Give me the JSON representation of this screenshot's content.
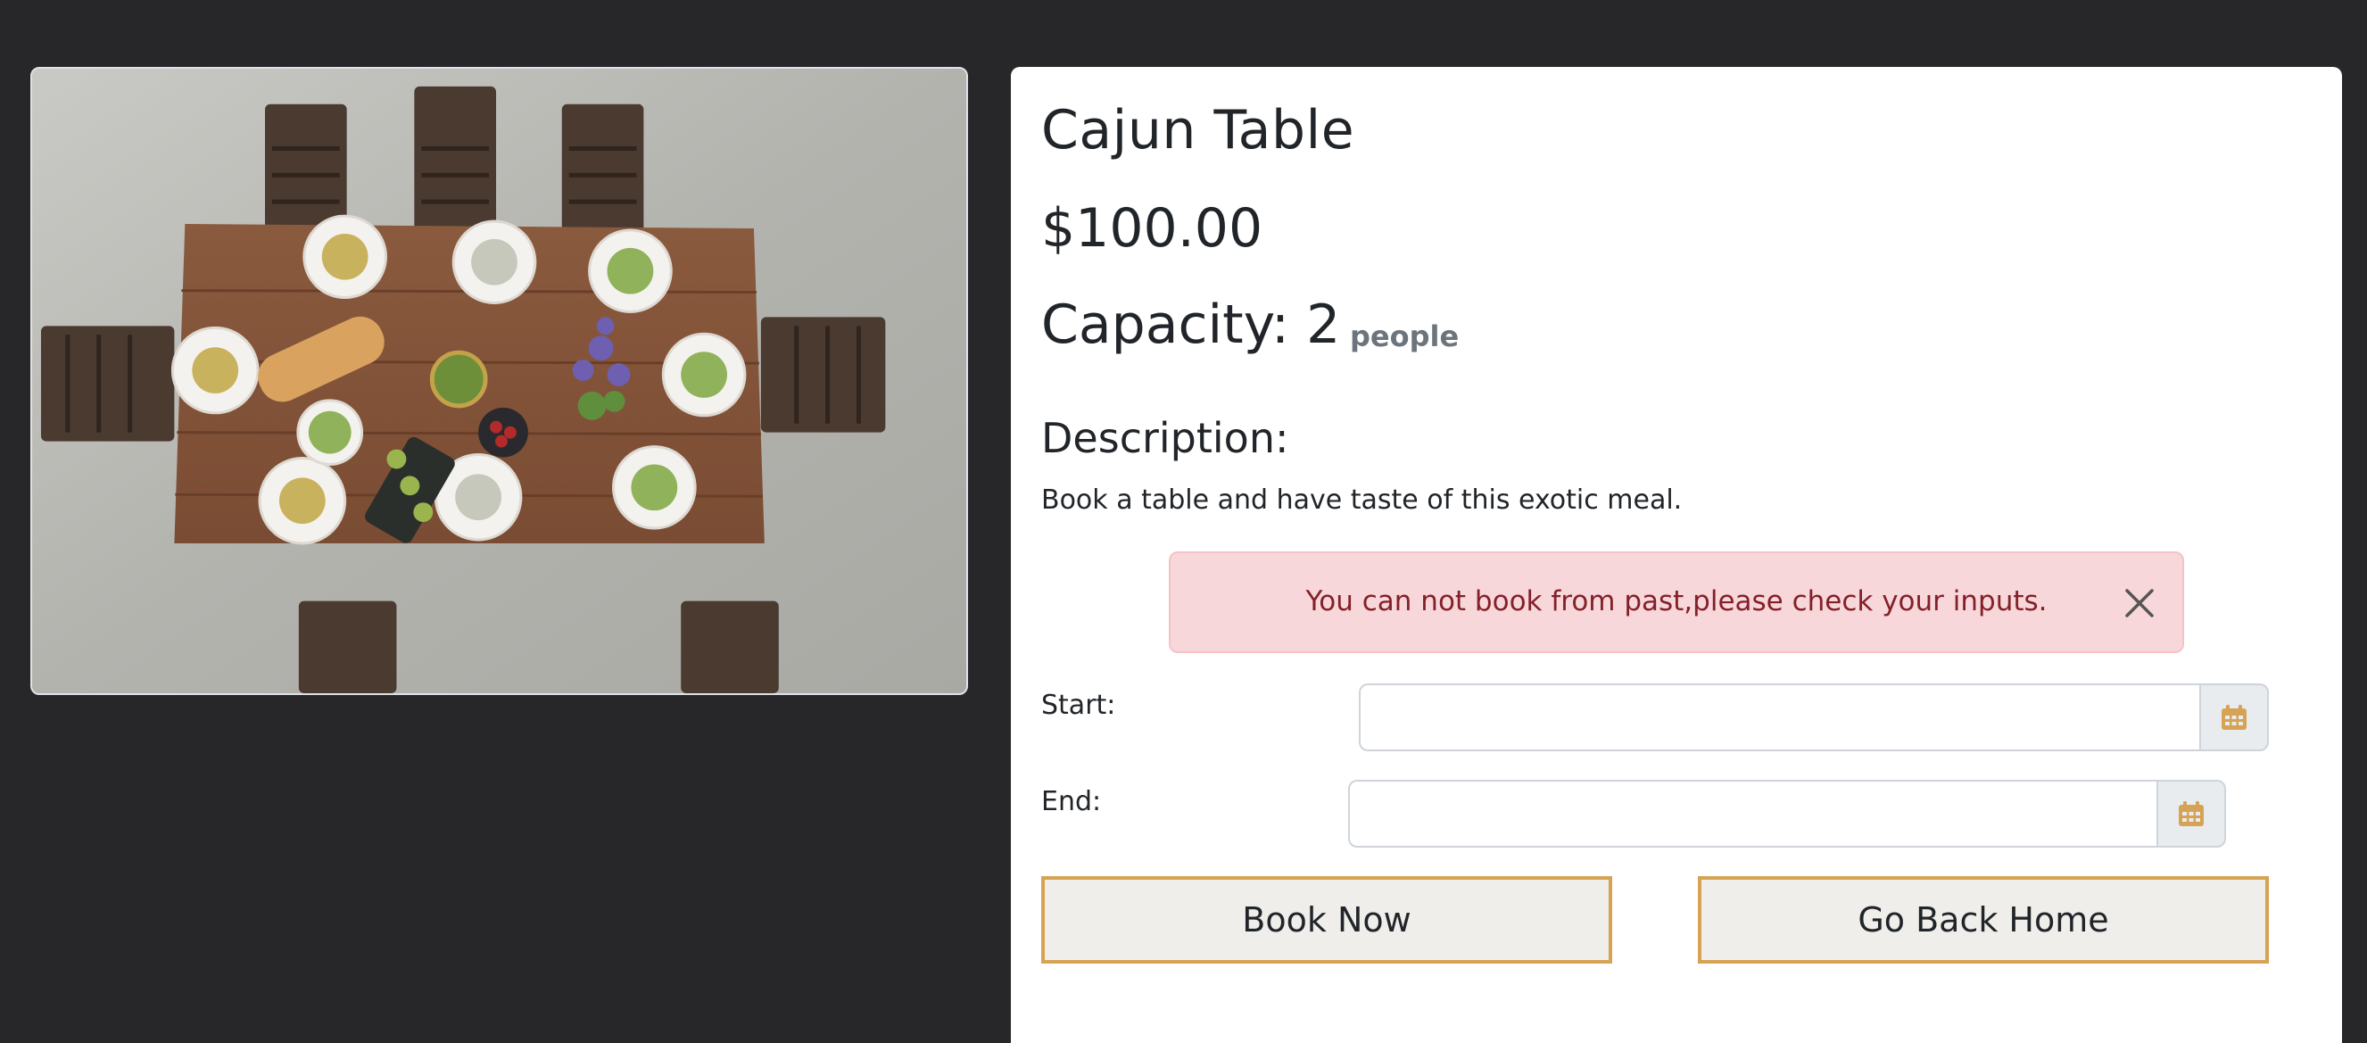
{
  "product": {
    "title": "Cajun Table",
    "price": "$100.00",
    "capacity_label": "Capacity: 2",
    "capacity_unit": "people",
    "description_heading": "Description:",
    "description_text": "Book a table and have taste of this exotic meal.",
    "image_icon": "table-photo"
  },
  "alert": {
    "message": "You can not book from past,please check your inputs.",
    "close_icon": "close-icon",
    "background": "#f8d7da",
    "text_color": "#842029"
  },
  "form": {
    "start_label": "Start:",
    "start_value": "",
    "end_label": "End:",
    "end_value": "",
    "calendar_icon": "calendar-icon"
  },
  "buttons": {
    "book_label": "Book Now",
    "home_label": "Go Back Home"
  },
  "colors": {
    "page_background": "#27272a",
    "accent": "#d6a354",
    "button_background": "#efeeeb"
  }
}
